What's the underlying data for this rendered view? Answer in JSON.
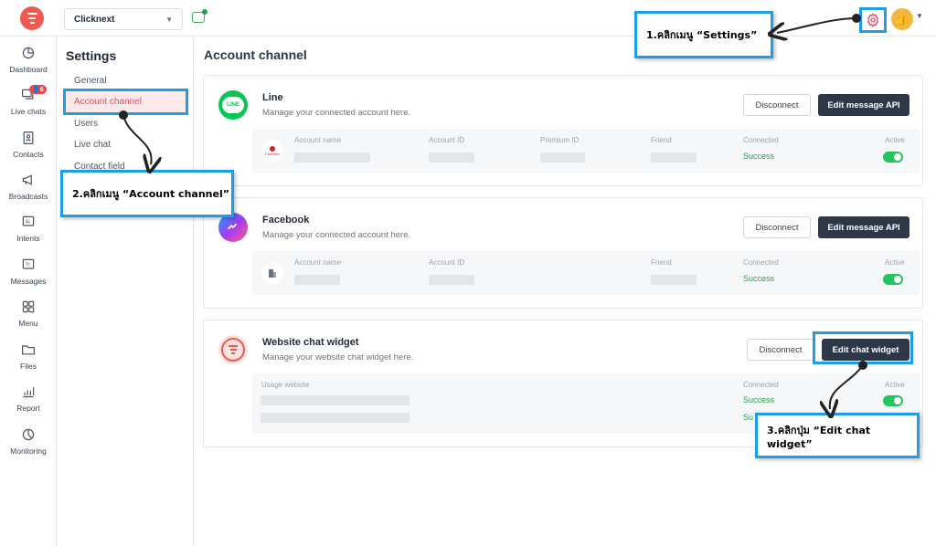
{
  "topbar": {
    "workspace": "Clicknext"
  },
  "nav": [
    {
      "label": "Dashboard",
      "icon": "pie-chart-icon"
    },
    {
      "label": "Live chats",
      "icon": "chat-bubbles-icon",
      "badge": "6"
    },
    {
      "label": "Contacts",
      "icon": "contact-card-icon"
    },
    {
      "label": "Broadcasts",
      "icon": "megaphone-icon"
    },
    {
      "label": "Intents",
      "icon": "intent-icon"
    },
    {
      "label": "Messages",
      "icon": "text-message-icon"
    },
    {
      "label": "Menu",
      "icon": "grid-icon"
    },
    {
      "label": "Files",
      "icon": "folder-icon"
    },
    {
      "label": "Report",
      "icon": "bar-chart-icon"
    },
    {
      "label": "Monitoring",
      "icon": "monitor-pie-icon"
    }
  ],
  "settings": {
    "title": "Settings",
    "items": [
      "General",
      "Account channel",
      "Users",
      "Live chat",
      "Contact field"
    ],
    "active": "Account channel"
  },
  "main": {
    "title": "Account channel",
    "line": {
      "name": "Line",
      "desc": "Manage your connected account here.",
      "logo_text": "LINE",
      "disconnect": "Disconnect",
      "edit": "Edit message API",
      "headers": {
        "account_name": "Account name",
        "account_id": "Account ID",
        "premium_id": "Premium ID",
        "friend": "Friend",
        "connected": "Connected",
        "active": "Active"
      },
      "row_icon_text": "Clicknext",
      "status": "Success"
    },
    "facebook": {
      "name": "Facebook",
      "desc": "Manage your connected account here.",
      "disconnect": "Disconnect",
      "edit": "Edit message API",
      "headers": {
        "account_name": "Account name",
        "account_id": "Account ID",
        "friend": "Friend",
        "connected": "Connected",
        "active": "Active"
      },
      "status": "Success"
    },
    "widget": {
      "name": "Website chat widget",
      "desc": "Manage your website chat widget here.",
      "disconnect": "Disconnect",
      "edit": "Edit chat widget",
      "headers": {
        "usage": "Usage website",
        "connected": "Connected",
        "active": "Active"
      },
      "status_1": "Success",
      "status_2_partial": "Su"
    }
  },
  "callouts": {
    "step1": "1.คลิกเมนู “Settings”",
    "step2": "2.คลิกเมนู “Account channel”",
    "step3": "3.คลิกปุ่ม “Edit chat widget”"
  },
  "colors": {
    "accent": "#e84a5f",
    "highlight": "#1e9ee8",
    "dark_button": "#2d3748",
    "success": "#22a447"
  }
}
